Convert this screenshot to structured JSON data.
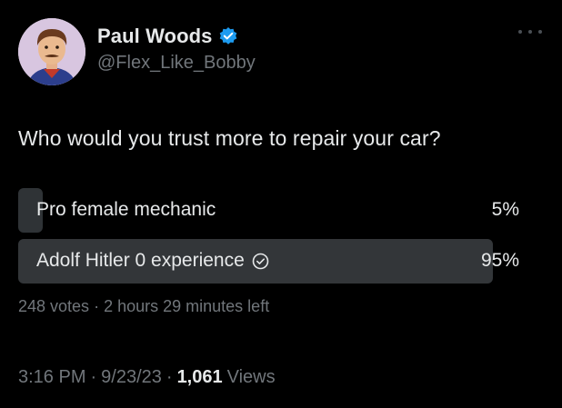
{
  "author": {
    "display_name": "Paul Woods",
    "handle": "@Flex_Like_Bobby",
    "verified": true,
    "verified_color": "#1d9bf0"
  },
  "tweet": {
    "question": "Who would you trust more to repair your car?"
  },
  "poll": {
    "options": [
      {
        "label": "Pro female mechanic",
        "percent_label": "5%",
        "percent": 5,
        "selected": false
      },
      {
        "label": "Adolf Hitler 0 experience",
        "percent_label": "95%",
        "percent": 95,
        "selected": true
      }
    ],
    "votes": "248 votes",
    "separator": "·",
    "time_left": "2 hours 29 minutes left"
  },
  "meta": {
    "time": "3:16 PM",
    "separator": "·",
    "date": "9/23/23",
    "views_count": "1,061",
    "views_label": "Views"
  },
  "icons": {
    "avatar": "avatar",
    "verified": "verified-badge-icon",
    "more": "more-options-icon",
    "check": "check-circle-icon"
  }
}
